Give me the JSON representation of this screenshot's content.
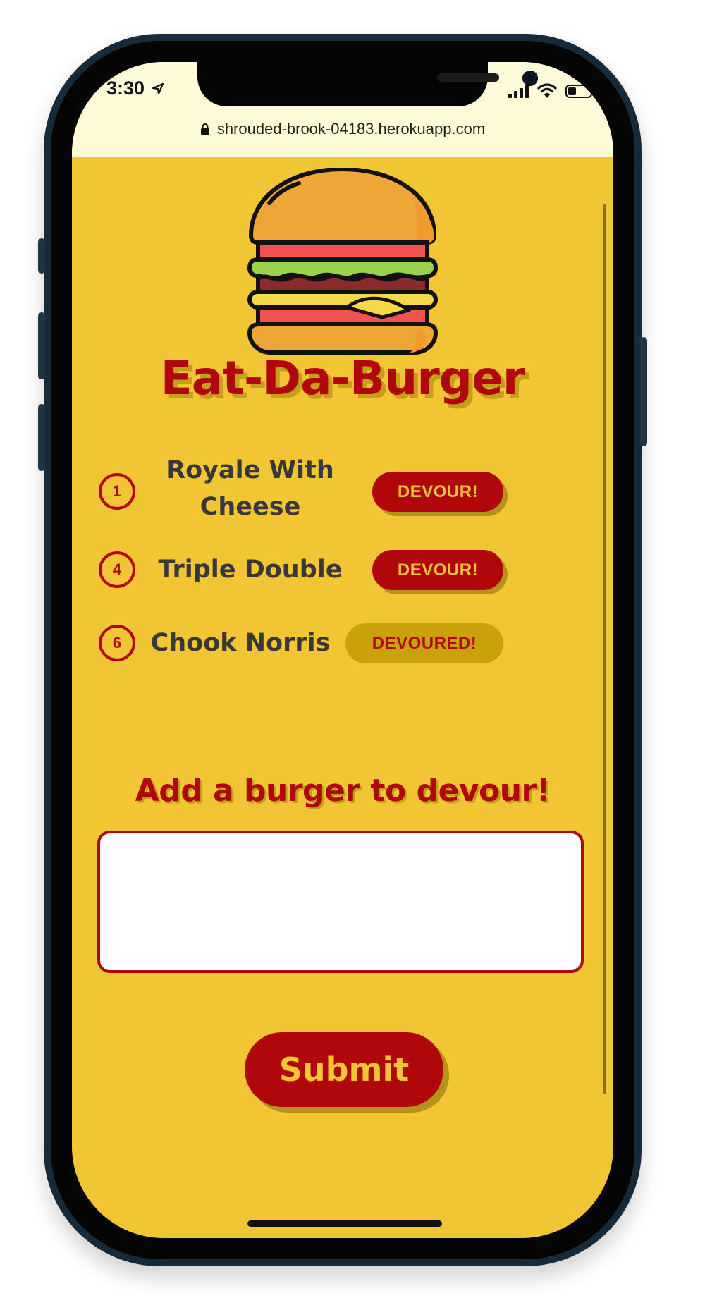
{
  "status_bar": {
    "time": "3:30",
    "battery_level": 0.35
  },
  "browser": {
    "url": "shrouded-brook-04183.herokuapp.com"
  },
  "app": {
    "title": "Eat-Da-Burger"
  },
  "burgers": [
    {
      "id": "1",
      "name": "Royale With Cheese",
      "button_label": "DEVOUR!",
      "devoured": false
    },
    {
      "id": "4",
      "name": "Triple Double",
      "button_label": "DEVOUR!",
      "devoured": false
    },
    {
      "id": "6",
      "name": "Chook Norris",
      "button_label": "DEVOURED!",
      "devoured": true
    }
  ],
  "form": {
    "heading": "Add a burger to devour!",
    "input_value": "",
    "input_placeholder": "",
    "submit_label": "Submit"
  },
  "colors": {
    "background": "#f2c535",
    "accent": "#b0070a",
    "devoured_button": "#c9a10a",
    "text": "#383838",
    "browser_bar": "#fdfbd8"
  },
  "icons": {
    "logo": "burger-icon",
    "location": "location-arrow-icon",
    "lock": "lock-icon"
  }
}
